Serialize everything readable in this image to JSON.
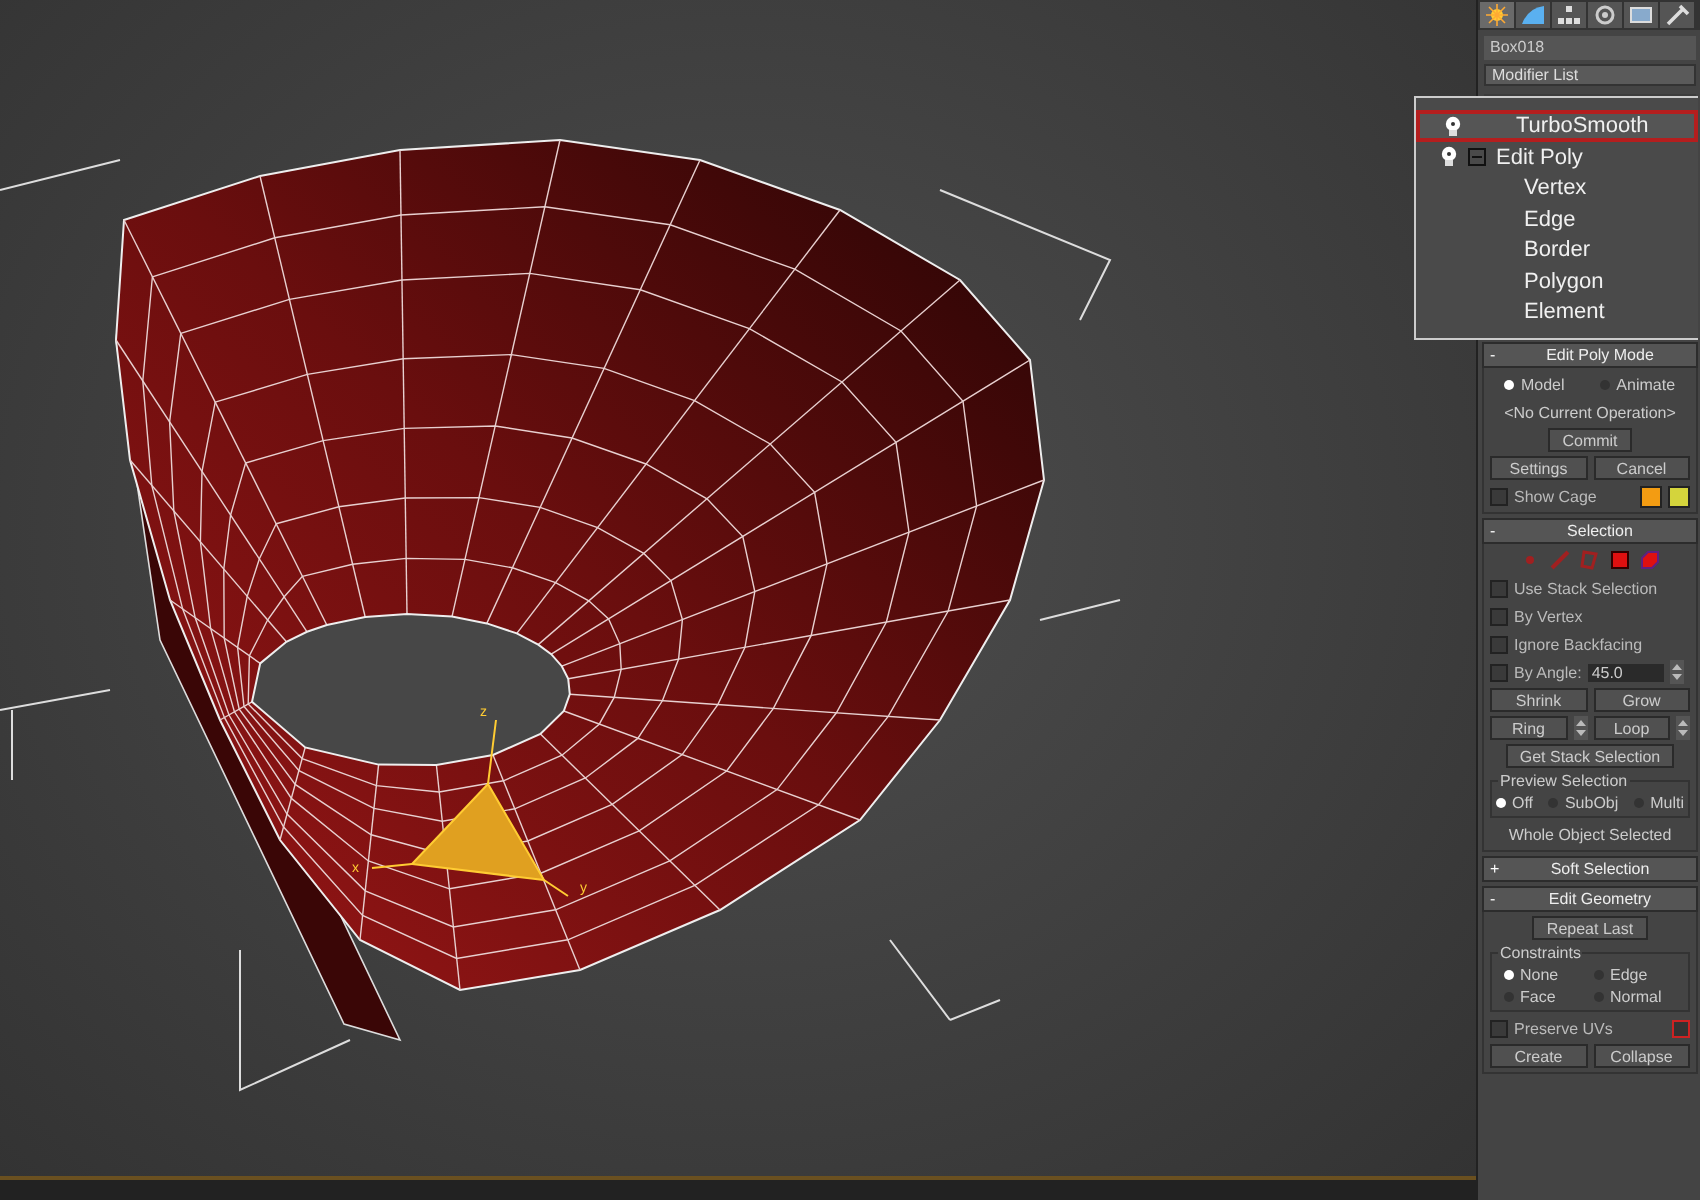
{
  "viewport": {
    "gizmo_axes": [
      {
        "kind": "z",
        "label": "z"
      },
      {
        "kind": "x",
        "label": "x"
      },
      {
        "kind": "y",
        "label": "y"
      }
    ]
  },
  "command_tabs": [
    {
      "kind": "create",
      "selected": true
    },
    {
      "kind": "modify",
      "selected": false
    },
    {
      "kind": "hierarchy",
      "selected": false
    },
    {
      "kind": "motion",
      "selected": false
    },
    {
      "kind": "display",
      "selected": false
    },
    {
      "kind": "utilities",
      "selected": false
    }
  ],
  "object_name": "Box018",
  "modifier_list": "Modifier List",
  "modifier_stack": [
    {
      "label": "TurboSmooth",
      "selected": true
    },
    {
      "label": "Edit Poly",
      "selected": false,
      "expanded": true,
      "children": [
        {
          "label": "Vertex"
        },
        {
          "label": "Edge"
        },
        {
          "label": "Border"
        },
        {
          "label": "Polygon"
        },
        {
          "label": "Element"
        }
      ]
    }
  ],
  "rollouts": [
    {
      "toggle": "-",
      "title": "Edit Poly Mode",
      "items": [
        {
          "kind": "radios",
          "options": [
            {
              "label": "Model",
              "selected": true
            },
            {
              "label": "Animate",
              "selected": false
            }
          ]
        },
        {
          "kind": "text",
          "text": "<No Current Operation>"
        },
        {
          "kind": "buttons",
          "buttons": [
            "Commit"
          ]
        },
        {
          "kind": "buttons",
          "buttons": [
            "Settings",
            "Cancel"
          ]
        },
        {
          "kind": "check",
          "label": "Show Cage",
          "checked": false,
          "swatches": [
            {
              "color": "#f39c12"
            },
            {
              "color": "#d4d43c"
            }
          ]
        }
      ]
    },
    {
      "toggle": "-",
      "title": "Selection",
      "items": [
        {
          "kind": "subobj",
          "icons": [
            {
              "kind": "vertex"
            },
            {
              "kind": "edge"
            },
            {
              "kind": "border"
            },
            {
              "kind": "polygon"
            },
            {
              "kind": "element"
            }
          ]
        },
        {
          "kind": "check",
          "label": "Use Stack Selection",
          "checked": false
        },
        {
          "kind": "check",
          "label": "By Vertex",
          "checked": false
        },
        {
          "kind": "check",
          "label": "Ignore Backfacing",
          "checked": false
        },
        {
          "kind": "check",
          "label": "By Angle:",
          "checked": false,
          "value": "45.0"
        },
        {
          "kind": "buttons",
          "buttons": [
            "Shrink",
            "Grow"
          ]
        },
        {
          "kind": "spinbuttons",
          "buttons": [
            "Ring",
            "Loop"
          ]
        },
        {
          "kind": "buttons",
          "buttons": [
            "Get Stack Selection"
          ]
        },
        {
          "kind": "group",
          "title": "Preview Selection",
          "options": [
            {
              "label": "Off",
              "selected": true
            },
            {
              "label": "SubObj",
              "selected": false
            },
            {
              "label": "Multi",
              "selected": false
            }
          ]
        },
        {
          "kind": "text",
          "text": "Whole Object Selected"
        }
      ]
    },
    {
      "toggle": "+",
      "title": "Soft Selection"
    },
    {
      "toggle": "-",
      "title": "Edit Geometry",
      "items": [
        {
          "kind": "buttons",
          "buttons": [
            "Repeat Last"
          ]
        },
        {
          "kind": "group2",
          "title": "Constraints",
          "options": [
            {
              "label": "None",
              "selected": true
            },
            {
              "label": "Edge",
              "selected": false
            },
            {
              "label": "Face",
              "selected": false
            },
            {
              "label": "Normal",
              "selected": false
            }
          ]
        },
        {
          "kind": "checkbtn",
          "label": "Preserve UVs",
          "checked": false
        },
        {
          "kind": "buttons",
          "buttons": [
            "Create",
            "Collapse"
          ]
        }
      ]
    }
  ]
}
